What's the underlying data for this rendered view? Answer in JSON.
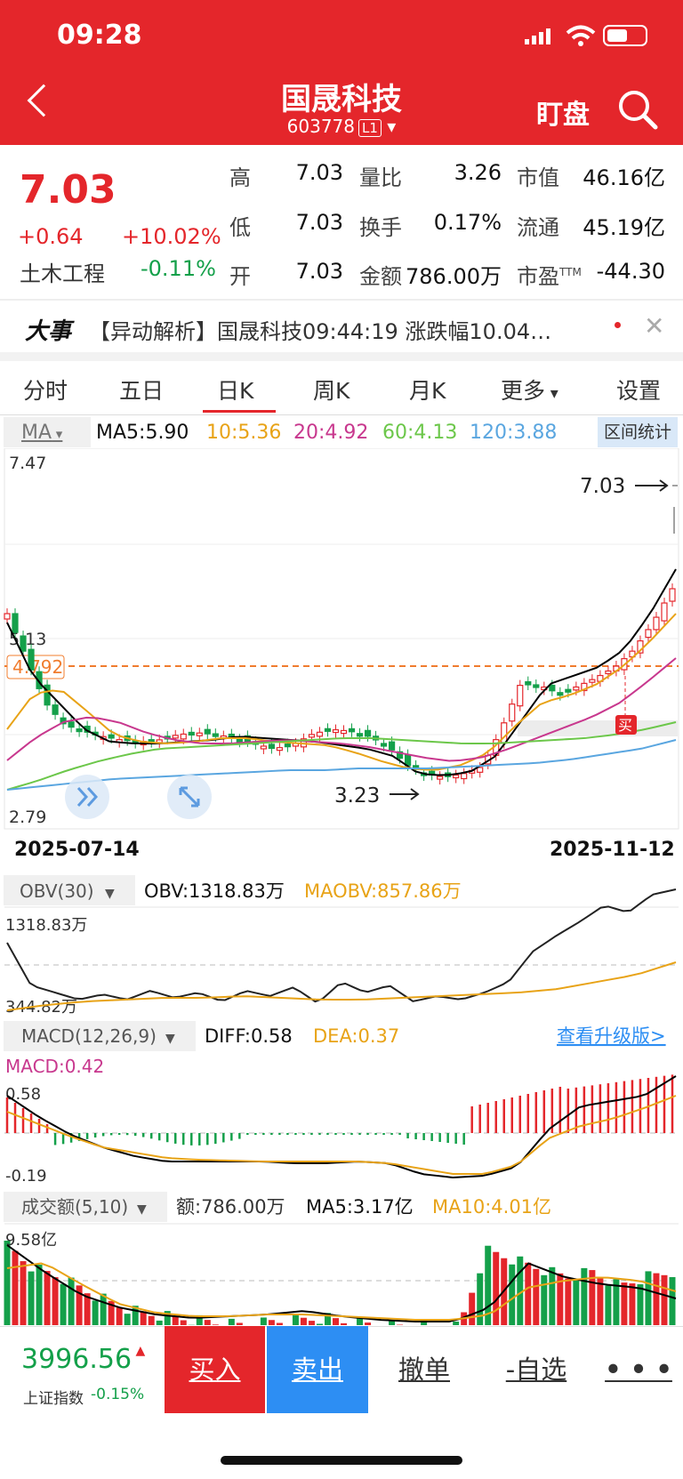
{
  "status": {
    "time": "09:28"
  },
  "header": {
    "name": "国晟科技",
    "code": "603778",
    "level": "L1",
    "watch": "盯盘"
  },
  "quote": {
    "price": "7.03",
    "change": "+0.64",
    "change_pct": "+10.02%",
    "industry": "土木工程",
    "industry_pct": "-0.11%",
    "rows": [
      {
        "l1": "高",
        "v1": "7.03",
        "l2": "量比",
        "v2": "3.26",
        "l3": "市值",
        "v3": "46.16亿"
      },
      {
        "l1": "低",
        "v1": "7.03",
        "l2": "换手",
        "v2": "0.17%",
        "l3": "流通",
        "v3": "45.19亿"
      },
      {
        "l1": "开",
        "v1": "7.03",
        "l2": "金额",
        "v2": "786.00万",
        "l3": "市盈",
        "v3": "-44.30"
      }
    ],
    "pe_sup": "TTM"
  },
  "news": {
    "tag": "大事",
    "text": "【异动解析】国晟科技09:44:19 涨跌幅10.04…"
  },
  "tabs": [
    "分时",
    "五日",
    "日K",
    "周K",
    "月K",
    "更多",
    "设置"
  ],
  "active_tab": "日K",
  "ma_legend": {
    "selector": "MA",
    "ma5": "MA5:5.90",
    "ma10": "10:5.36",
    "ma20": "20:4.92",
    "ma60": "60:4.13",
    "ma120": "120:3.88",
    "range_button": "区间统计",
    "colors": {
      "ma5": "#000000",
      "ma10": "#e8a317",
      "ma20": "#c8388e",
      "ma60": "#6cc74a",
      "ma120": "#5aa6e0"
    }
  },
  "kline": {
    "y_max": "7.47",
    "y_mid": "5.13",
    "y_min": "2.79",
    "cost_line": "4.792",
    "high_mark": "7.03",
    "low_mark": "3.23",
    "buy_tag": "买",
    "date_start": "2025-07-14",
    "date_end": "2025-11-12"
  },
  "obv": {
    "selector": "OBV(30)",
    "obv": "OBV:1318.83万",
    "maobv": "MAOBV:857.86万",
    "top": "1318.83万",
    "bottom": "344.82万"
  },
  "macd": {
    "selector": "MACD(12,26,9)",
    "diff": "DIFF:0.58",
    "dea": "DEA:0.37",
    "upgrade": "查看升级版>",
    "macd": "MACD:0.42",
    "top": "0.58",
    "bottom": "-0.19"
  },
  "volume": {
    "selector": "成交额(5,10)",
    "amount": "额:786.00万",
    "ma5": "MA5:3.17亿",
    "ma10": "MA10:4.01亿",
    "top": "9.58亿"
  },
  "bottom": {
    "index_value": "3996.56",
    "index_name": "上证指数",
    "index_pct": "-0.15%",
    "buy": "买入",
    "sell": "卖出",
    "cancel": "撤单",
    "fav": "-自选",
    "more": "• • •"
  }
}
